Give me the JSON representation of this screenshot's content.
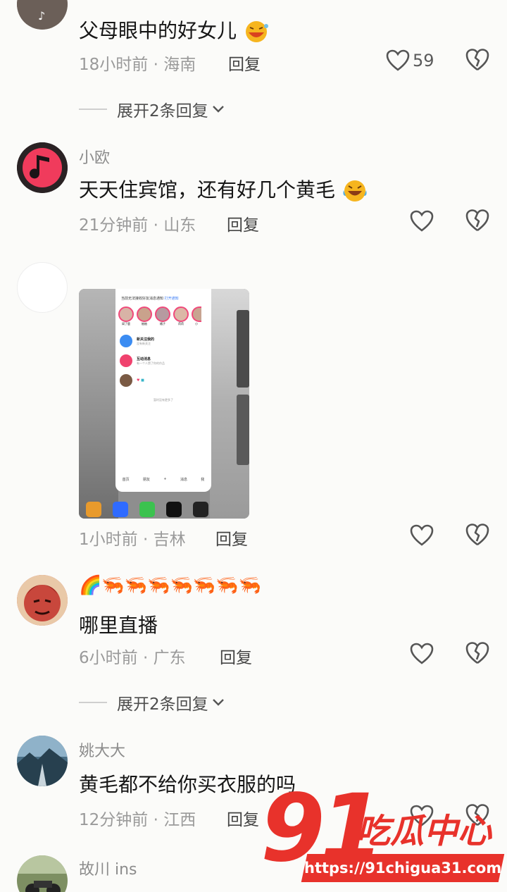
{
  "comments": [
    {
      "text": "父母眼中的好女儿",
      "time": "18小时前",
      "location": "海南",
      "reply_label": "回复",
      "likes": "59",
      "expand_label": "展开2条回复"
    },
    {
      "username": "小欧",
      "text": "天天住宾馆，还有好几个黄毛",
      "time": "21分钟前",
      "location": "山东",
      "reply_label": "回复"
    },
    {
      "time": "1小时前",
      "location": "吉林",
      "reply_label": "回复"
    },
    {
      "username_emoji": "🌈🦐🦐🦐🦐🦐🦐🦐",
      "text": "哪里直播",
      "time": "6小时前",
      "location": "广东",
      "reply_label": "回复",
      "expand_label": "展开2条回复"
    },
    {
      "username": "姚大大",
      "text": "黄毛都不给你买衣服的吗",
      "time": "12分钟前",
      "location": "江西",
      "reply_label": "回复"
    },
    {
      "username": "故川 ins"
    }
  ],
  "separator": " · ",
  "thumbnail": {
    "banner": "当前无法接收好友消息通知",
    "banner_action": "打开通知",
    "stories": [
      "闺了鹿",
      "柚柚",
      "橘子",
      "荷荷",
      "小"
    ],
    "rows": [
      {
        "title": "新关注我的",
        "sub": "没有新关注"
      },
      {
        "title": "互动消息",
        "sub": "有一个人赞了你的作品"
      },
      {
        "title": "",
        "sub": ""
      }
    ],
    "footer_note": "暂时没有更多了",
    "tabs": [
      "首页",
      "朋友",
      "+",
      "消息",
      "我"
    ]
  },
  "watermark": {
    "number": "91",
    "name": "吃瓜中心",
    "url": "https://91chigua31.com"
  },
  "colors": {
    "accent": "#e8322b",
    "meta": "#9a9a9a"
  }
}
